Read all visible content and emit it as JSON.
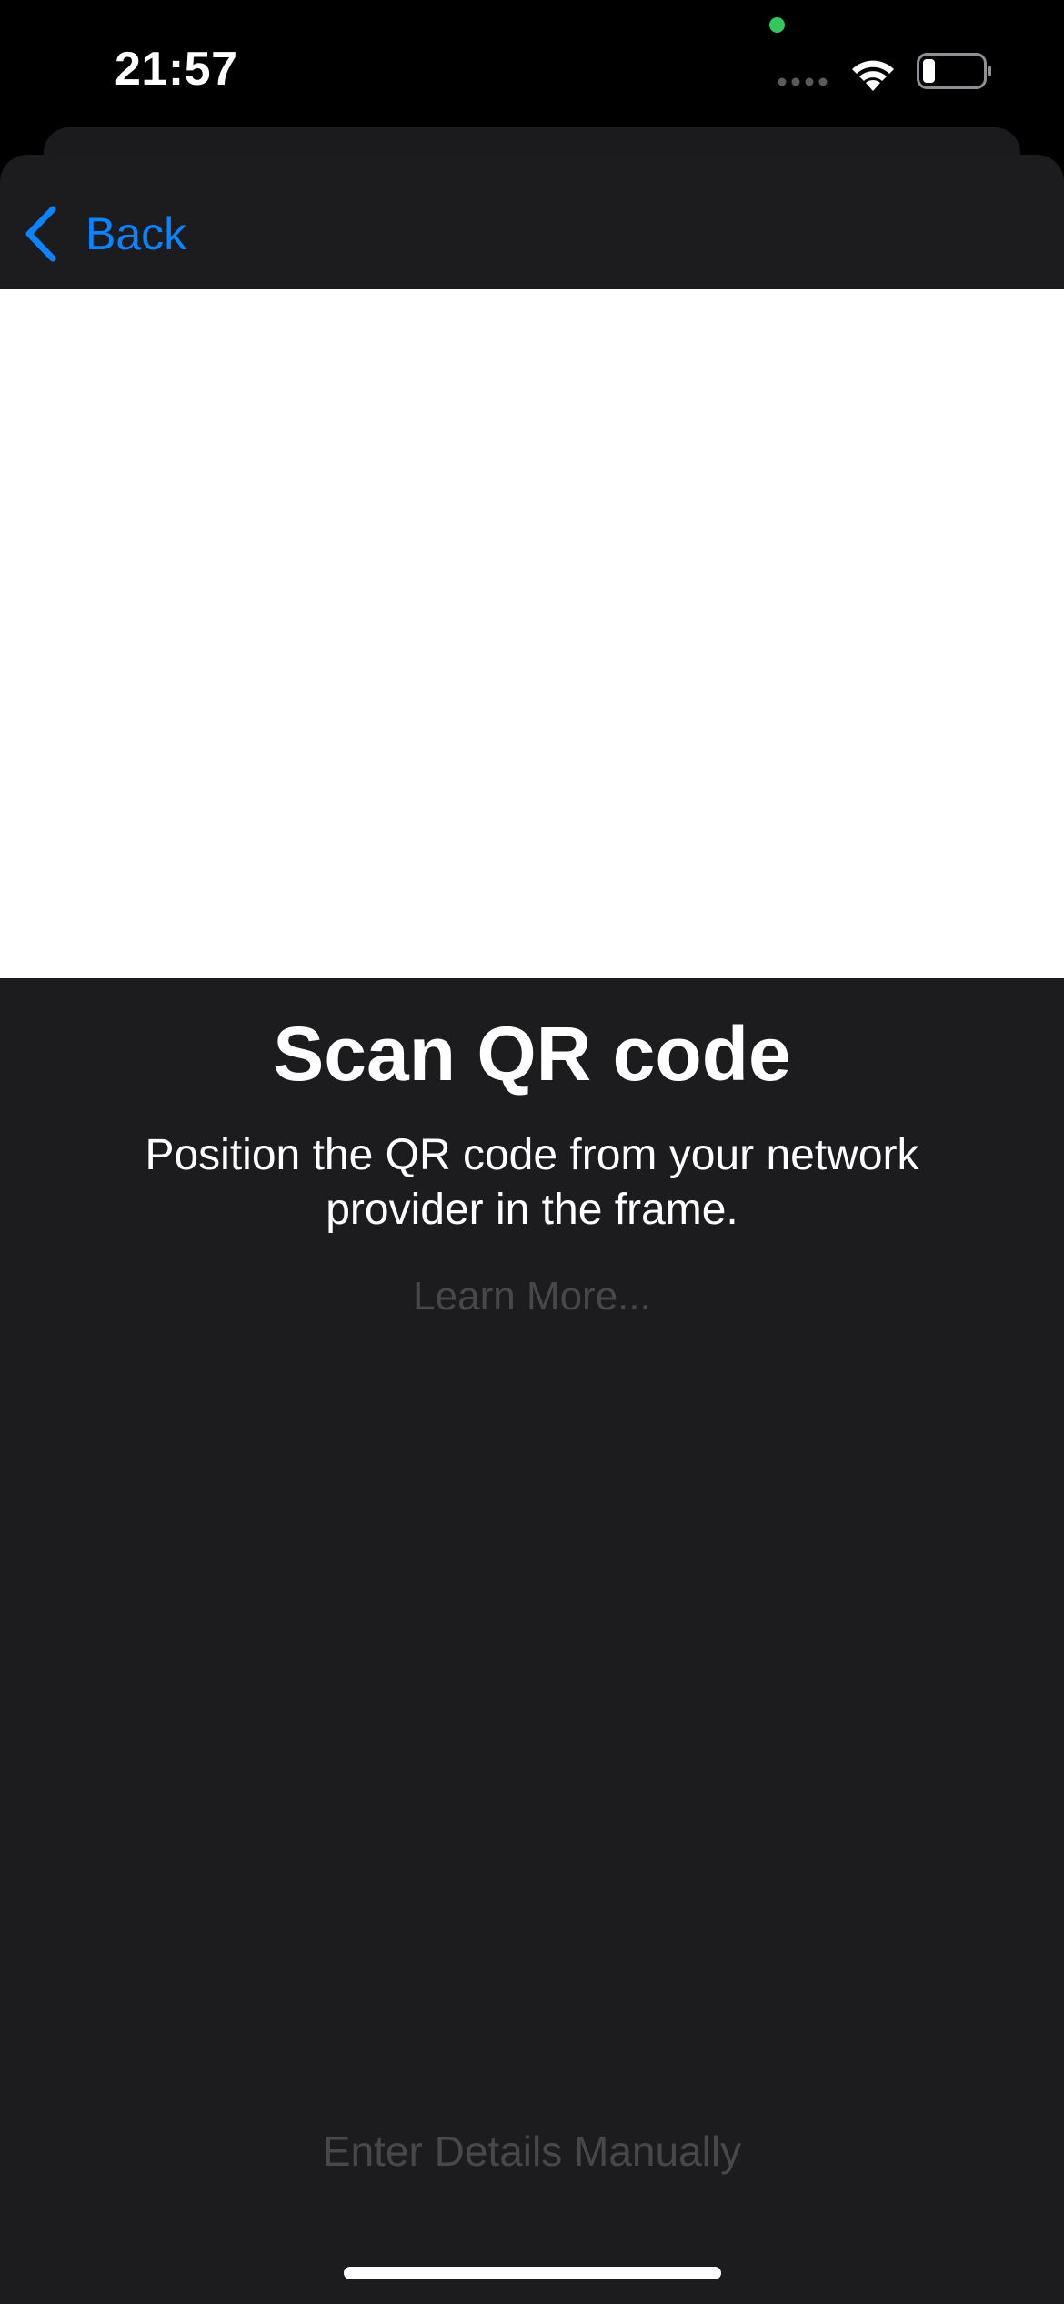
{
  "status_bar": {
    "time": "21:57",
    "privacy_indicator_color": "#34c759",
    "icons": [
      "cellular-signal-icon",
      "wifi-icon",
      "battery-icon"
    ],
    "battery_level": 0.2
  },
  "nav": {
    "back_label": "Back",
    "back_icon": "chevron-left-icon"
  },
  "main": {
    "title": "Scan QR code",
    "subtitle": "Position the QR code from your network provider in the frame.",
    "learn_more": "Learn More...",
    "manual_entry": "Enter Details Manually"
  },
  "colors": {
    "accent": "#0a84ff",
    "background": "#1c1c1e",
    "disabled_text": "#48484a",
    "camera_frame": "#ffffff"
  }
}
